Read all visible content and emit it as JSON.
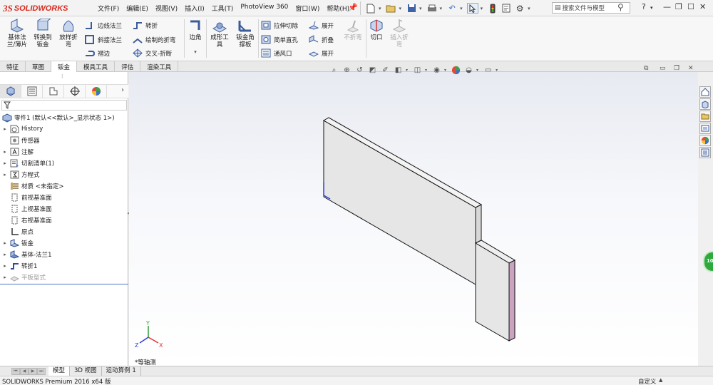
{
  "app": {
    "logo_mark": "3S",
    "logo_text": "SOLIDWORKS"
  },
  "menu": [
    "文件(F)",
    "编辑(E)",
    "视图(V)",
    "插入(I)",
    "工具(T)",
    "PhotoView 360",
    "窗口(W)",
    "帮助(H)"
  ],
  "search": {
    "placeholder": "搜索文件与模型"
  },
  "help_label": "?",
  "ribbon": {
    "base_flange": "基体法\n兰/薄片",
    "convert_to_sheetmetal": "转换到\n钣金",
    "lofted_bend": "放样折\n弯",
    "edge_flange": "边线法兰",
    "miter_flange": "斜接法兰",
    "hem": "褶边",
    "jog": "转折",
    "sketched_bend": "绘制的折弯",
    "cross_break": "交叉-折断",
    "corner": "边角",
    "forming_tool": "成形工\n具",
    "sheetmetal_gusset": "钣金角\n撑板",
    "extruded_cut": "拉伸切除",
    "simple_hole": "简单直孔",
    "vent": "通风口",
    "unfold": "展开",
    "fold": "折叠",
    "flatten": "展开",
    "no_bends": "不折弯",
    "rip": "切口",
    "insert_bends": "插入折\n弯"
  },
  "tabs": [
    "特征",
    "草图",
    "钣金",
    "模具工具",
    "评估",
    "渲染工具"
  ],
  "active_tab_index": 2,
  "tree": {
    "root": "零件1 (默认<<默认>_显示状态 1>)",
    "items": [
      {
        "label": "History",
        "twisty": "▸"
      },
      {
        "label": "传感器",
        "twisty": ""
      },
      {
        "label": "注解",
        "twisty": "▸"
      },
      {
        "label": "切割清单(1)",
        "twisty": "▸"
      },
      {
        "label": "方程式",
        "twisty": "▸"
      },
      {
        "label": "材质 <未指定>",
        "twisty": ""
      },
      {
        "label": "前视基准面",
        "twisty": ""
      },
      {
        "label": "上视基准面",
        "twisty": ""
      },
      {
        "label": "右视基准面",
        "twisty": ""
      },
      {
        "label": "原点",
        "twisty": ""
      },
      {
        "label": "钣金",
        "twisty": "▸"
      },
      {
        "label": "基体-法兰1",
        "twisty": "▸"
      },
      {
        "label": "转折1",
        "twisty": "▸"
      },
      {
        "label": "平板型式",
        "twisty": "▸"
      }
    ]
  },
  "viewport": {
    "view_label": "*等轴测",
    "green_button_text": "10"
  },
  "triad": {
    "x": "X",
    "y": "Y",
    "z": "Z"
  },
  "bottom_tabs": [
    "模型",
    "3D 视图",
    "运动算例 1"
  ],
  "active_bottom_tab_index": 0,
  "status": {
    "product": "SOLIDWORKS Premium 2016 x64 版",
    "units": "自定义"
  },
  "colors": {
    "brand_red": "#d62b1f",
    "selection_blue": "#4a79c2",
    "part_face": "#e4e4e4",
    "part_edge_pink": "#c9a3bf"
  }
}
